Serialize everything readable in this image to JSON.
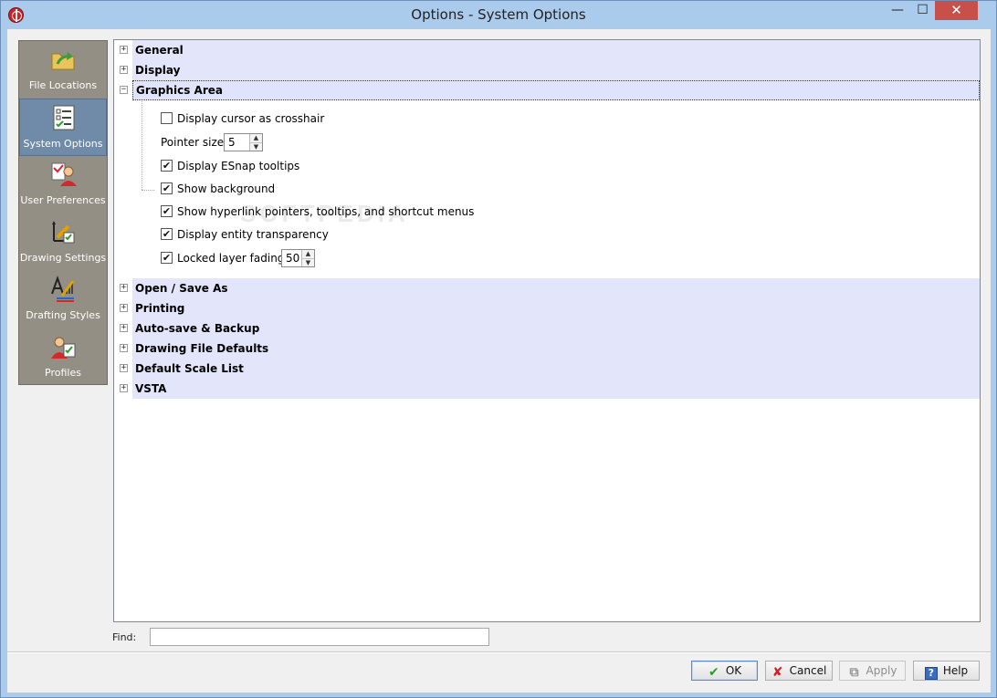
{
  "window": {
    "title": "Options - System Options",
    "controls": {
      "minimize": "—",
      "maximize": "☐",
      "close": "✕"
    }
  },
  "sidebar": {
    "items": [
      {
        "label": "File Locations",
        "icon": "folder-arrow-icon",
        "active": false
      },
      {
        "label": "System Options",
        "icon": "checklist-icon",
        "active": true
      },
      {
        "label": "User Preferences",
        "icon": "user-preferences-icon",
        "active": false
      },
      {
        "label": "Drawing Settings",
        "icon": "drawing-settings-icon",
        "active": false
      },
      {
        "label": "Drafting Styles",
        "icon": "drafting-styles-icon",
        "active": false
      },
      {
        "label": "Profiles",
        "icon": "profiles-icon",
        "active": false
      }
    ]
  },
  "tree": {
    "sections_top": [
      {
        "label": "General",
        "expander": "+"
      },
      {
        "label": "Display",
        "expander": "+"
      },
      {
        "label": "Graphics Area",
        "expander": "−",
        "selected": true
      }
    ],
    "graphics_area": {
      "crosshair": {
        "label": "Display cursor as crosshair",
        "checked": false
      },
      "pointer_size": {
        "label": "Pointer size:",
        "value": "5"
      },
      "esnap_tooltips": {
        "label": "Display ESnap tooltips",
        "checked": true
      },
      "show_background": {
        "label": "Show background",
        "checked": true
      },
      "hyperlink": {
        "label": "Show hyperlink pointers, tooltips, and shortcut menus",
        "checked": true
      },
      "transparency": {
        "label": "Display entity transparency",
        "checked": true
      },
      "layer_fading": {
        "label": "Locked layer fading",
        "checked": true,
        "value": "50"
      }
    },
    "sections_bottom": [
      {
        "label": "Open / Save As",
        "expander": "+"
      },
      {
        "label": "Printing",
        "expander": "+"
      },
      {
        "label": "Auto-save & Backup",
        "expander": "+"
      },
      {
        "label": "Drawing File Defaults",
        "expander": "+"
      },
      {
        "label": "Default Scale List",
        "expander": "+"
      },
      {
        "label": "VSTA",
        "expander": "+"
      }
    ]
  },
  "find": {
    "label": "Find:",
    "value": ""
  },
  "buttons": {
    "ok": "OK",
    "cancel": "Cancel",
    "apply": "Apply",
    "help": "Help"
  },
  "watermark": "SOFTPEDIA",
  "colors": {
    "title_bar": "#aacbec",
    "close_button": "#c7504b",
    "sidebar": "#948f84",
    "sidebar_active": "#6f8ba8",
    "section_header": "#e3e6fb",
    "ok_check": "#2e9a2e",
    "cancel_x": "#d21e1e"
  }
}
